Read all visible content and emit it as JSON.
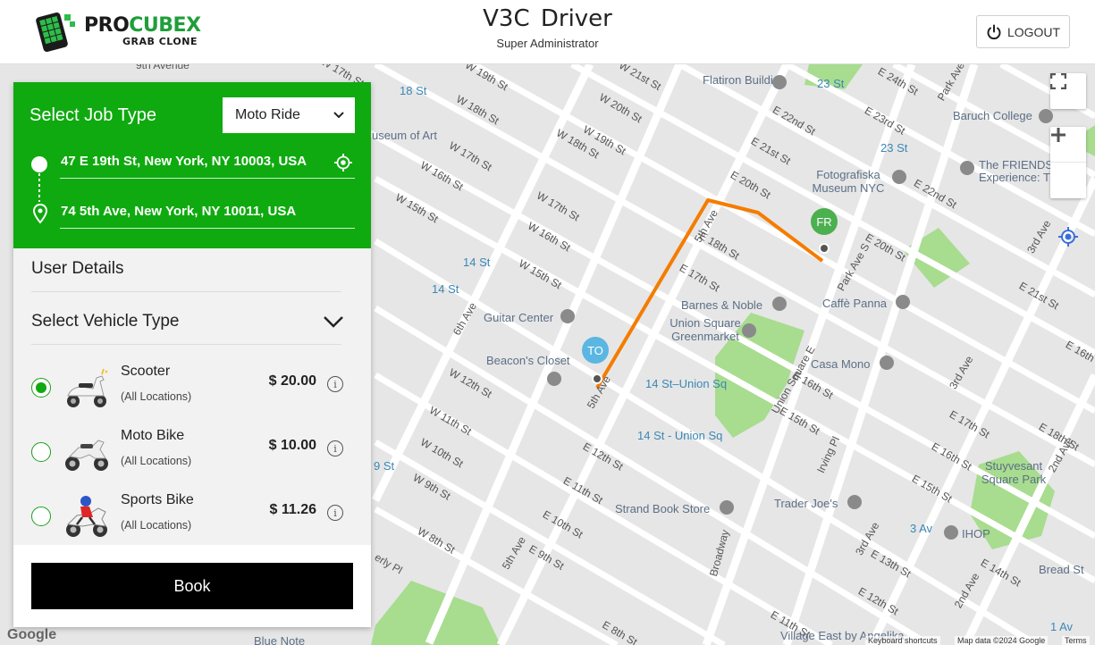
{
  "header": {
    "logo_main": "PRO",
    "logo_accent": "CUBEX",
    "logo_sub": "GRAB CLONE",
    "title": "V3C  Driver",
    "subtitle": "Super Administrator",
    "logout_label": "LOGOUT"
  },
  "booking": {
    "job_type_label": "Select Job Type",
    "job_type_value": "Moto Ride",
    "pickup_address": "47 E 19th St, New York, NY 10003, USA",
    "dropoff_address": "74 5th Ave, New York, NY 10011, USA",
    "user_details_label": "User Details",
    "vehicle_type_label": "Select Vehicle Type",
    "vehicles": [
      {
        "name": "Scooter",
        "location": "(All Locations)",
        "price": "$ 20.00",
        "selected": true
      },
      {
        "name": "Moto Bike",
        "location": "(All Locations)",
        "price": "$ 10.00",
        "selected": false
      },
      {
        "name": "Sports Bike",
        "location": "(All Locations)",
        "price": "$ 11.26",
        "selected": false
      }
    ],
    "book_label": "Book"
  },
  "map": {
    "streets": [
      "9th Avenue",
      "W 17th St",
      "W 19th St",
      "W 18th St",
      "W 21st St",
      "W 20th St",
      "W 19th St",
      "W 17th St",
      "W 16th St",
      "W 15th St",
      "W 18th St",
      "W 17th St",
      "W 16th St",
      "W 15th St",
      "W 12th St",
      "W 11th St",
      "W 10th St",
      "W 9th St",
      "W 8th St",
      "6th Ave",
      "5th Ave",
      "5th Ave",
      "E 22nd St",
      "E 21st St",
      "E 20th St",
      "E 18th St",
      "E 17th St",
      "E 16th St",
      "E 15th St",
      "E 12th St",
      "E 11th St",
      "E 10th St",
      "E 9th St",
      "E 8th St",
      "E 24th St",
      "E 23rd St",
      "E 22nd St",
      "E 20th St",
      "E 21st St",
      "E 17th St",
      "E 16th St",
      "E 15th St",
      "E 14th St",
      "E 13th St",
      "E 12th St",
      "E 11th St",
      "E 18th St",
      "Park Ave S",
      "Park Ave",
      "Union Square E",
      "Irving Pl",
      "Broadway",
      "3rd Ave",
      "3rd Ave",
      "3rd Ave",
      "2nd Ave",
      "2nd Ave",
      "erly Pl",
      "E 16th St",
      "5th Ave"
    ],
    "places": [
      "Flatiron Building",
      "Baruch College",
      "Fotografiska Museum NYC",
      "The FRIENDS Experience: T",
      "Barnes & Noble",
      "Union Square Greenmarket",
      "Caffè Panna",
      "Casa Mono",
      "Guitar Center",
      "Beacon's Closet",
      "Trader Joe's",
      "Strand Book Store",
      "Stuyvesant Square Park",
      "IHOP",
      "Bread St",
      "Blue Note",
      "Village East by Angelika",
      "useum of Art"
    ],
    "transit": [
      "18 St",
      "23 St",
      "23 St",
      "14 St",
      "14 St",
      "14 St–Union Sq",
      "14 St - Union Sq",
      "3 Av",
      "1 Av",
      "9 St"
    ],
    "pickup_marker": "FR",
    "dropoff_marker": "TO",
    "route_color": "#f57c00",
    "google_label": "Google",
    "footer_keyboard": "Keyboard shortcuts",
    "footer_data": "Map data ©2024 Google",
    "footer_terms": "Terms"
  }
}
